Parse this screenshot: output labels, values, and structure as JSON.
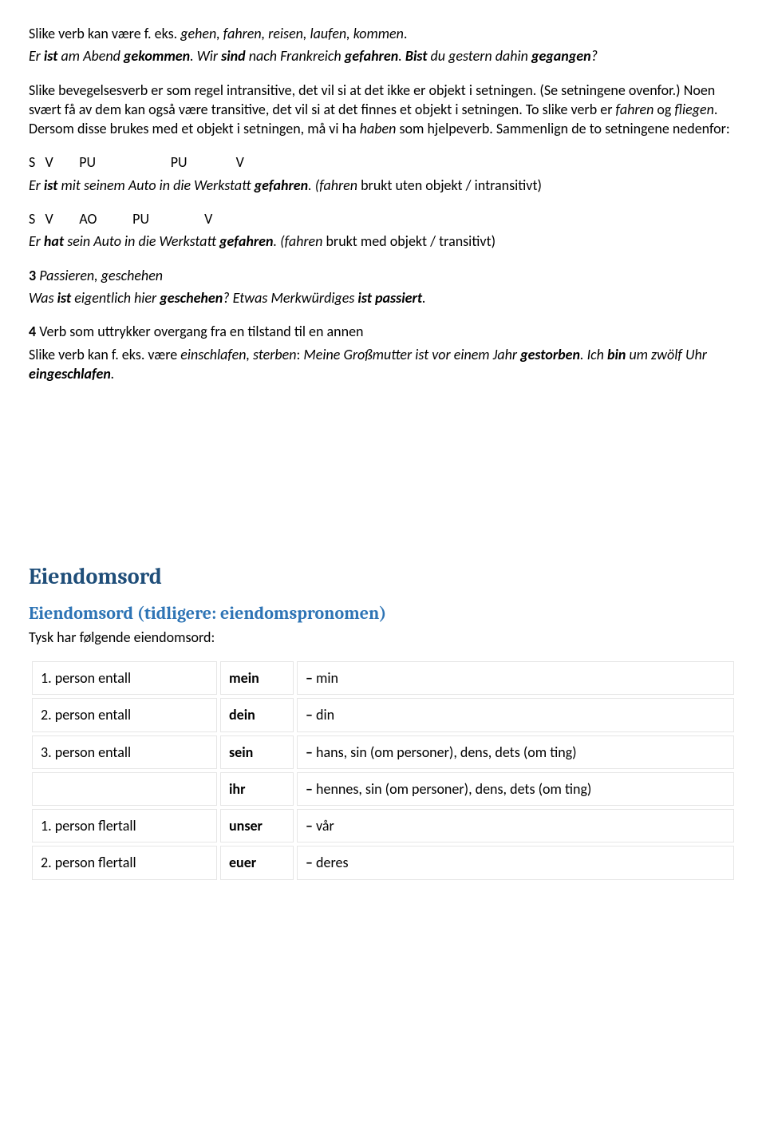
{
  "p1": {
    "a": "Slike verb kan være f. eks. ",
    "b": "gehen, fahren, reisen, laufen, kommen",
    "c": "."
  },
  "p2": {
    "a": "Er ",
    "b": "ist",
    "c": " am Abend ",
    "d": "gekommen",
    "e": ". Wir ",
    "f": "sind",
    "g": " nach Frankreich ",
    "h": "gefahren",
    "i": ". ",
    "j": "Bist",
    "k": " du gestern dahin ",
    "l": "gegangen",
    "m": "?"
  },
  "p3": {
    "a": "Slike bevegelsesverb er som regel intransitive, det vil si at det ikke er objekt i setningen. (Se setningene ovenfor.) Noen svært få av dem kan også være transitive, det vil si at det finnes et objekt i setningen. To slike verb er ",
    "b": "fahren",
    "c": " og ",
    "d": "fliegen",
    "e": ". Dersom disse brukes med et objekt i setningen, må vi ha ",
    "f": "haben",
    "g": " som hjelpeverb. Sammenlign de to setningene nedenfor:"
  },
  "svpu1": "S   V        PU                       PU               V",
  "ex1": {
    "a": "Er ",
    "b": "ist",
    "c": " mit seinem Auto in die Werkstatt ",
    "d": "gefahren",
    "e": ". (",
    "f": "fahren",
    "g": " brukt uten objekt / intransitivt)"
  },
  "svpu2": "S   V        AO           PU                 V",
  "ex2": {
    "a": "Er ",
    "b": "hat",
    "c": " sein Auto in die Werkstatt ",
    "d": "gefahren",
    "e": ". (",
    "f": "fahren",
    "g": " brukt med objekt / transitivt)"
  },
  "p4": {
    "a": "3",
    "b": " Passieren, geschehen"
  },
  "p5": {
    "a": "Was ",
    "b": "ist",
    "c": " eigentlich hier ",
    "d": "geschehen",
    "e": "? Etwas Merkwürdiges ",
    "f": "ist",
    "g": " ",
    "h": "passiert",
    "i": "."
  },
  "p6": {
    "a": "4",
    "b": " Verb som uttrykker overgang fra en tilstand til en annen"
  },
  "p7": {
    "a": "Slike verb kan f. eks. være ",
    "b": "einschlafen, sterben",
    "c": ": ",
    "d": "Meine Großmutter ist vor einem Jahr ",
    "e": "gestorben",
    "f": ". Ich ",
    "g": "bin",
    "h": " um zwölf Uhr ",
    "i": "eingeschlafen",
    "j": "."
  },
  "h1": "Eiendomsord",
  "h2": "Eiendomsord (tidligere: eiendomspronomen)",
  "intro": "Tysk har følgende eiendomsord:",
  "dash": "–",
  "table": [
    {
      "c1": "1. person entall",
      "c2": "mein",
      "c3": " min"
    },
    {
      "c1": "2. person entall",
      "c2": "dein",
      "c3": " din"
    },
    {
      "c1": "3. person entall",
      "c2": "sein",
      "c3": " hans, sin (om personer), dens, dets (om ting)"
    },
    {
      "c1": "",
      "c2": "ihr",
      "c3": " hennes, sin (om personer), dens, dets (om ting)"
    },
    {
      "c1": "1. person flertall",
      "c2": "unser",
      "c3": " vår"
    },
    {
      "c1": "2. person flertall",
      "c2": "euer",
      "c3": " deres"
    }
  ]
}
